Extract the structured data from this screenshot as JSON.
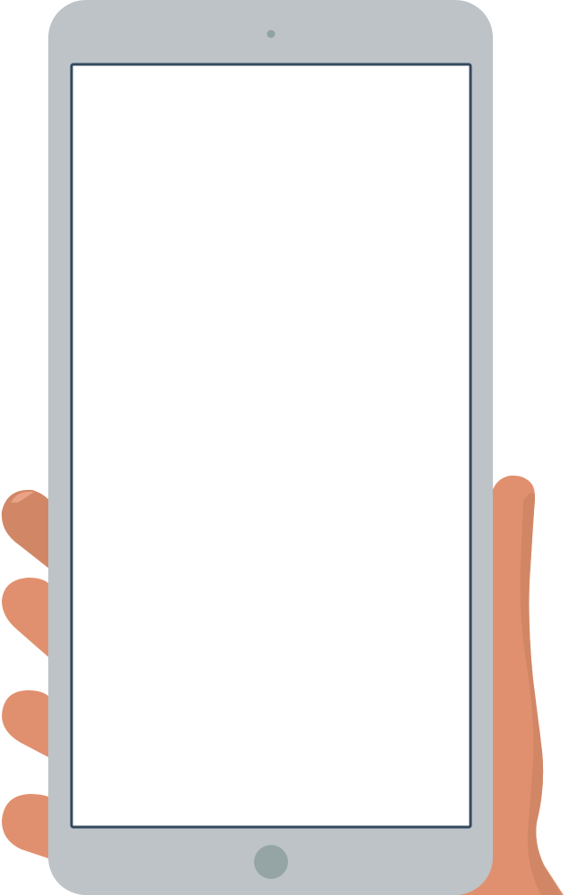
{
  "illustration": {
    "subject": "hand-holding-phone",
    "screen": {
      "content": ""
    }
  },
  "colors": {
    "phone_body": "#BDC3C7",
    "screen_fill": "#FFFFFF",
    "screen_border": "#34495E",
    "sensor_dot": "#8FA3A5",
    "home_button": "#95A5A6",
    "skin_light": "#E1906F",
    "skin_shadow": "#D18766",
    "skin_highlight": "#E9A286"
  },
  "icons": {
    "front_camera": "camera-icon",
    "home_button": "home-button-icon",
    "hand": "hand-icon"
  }
}
